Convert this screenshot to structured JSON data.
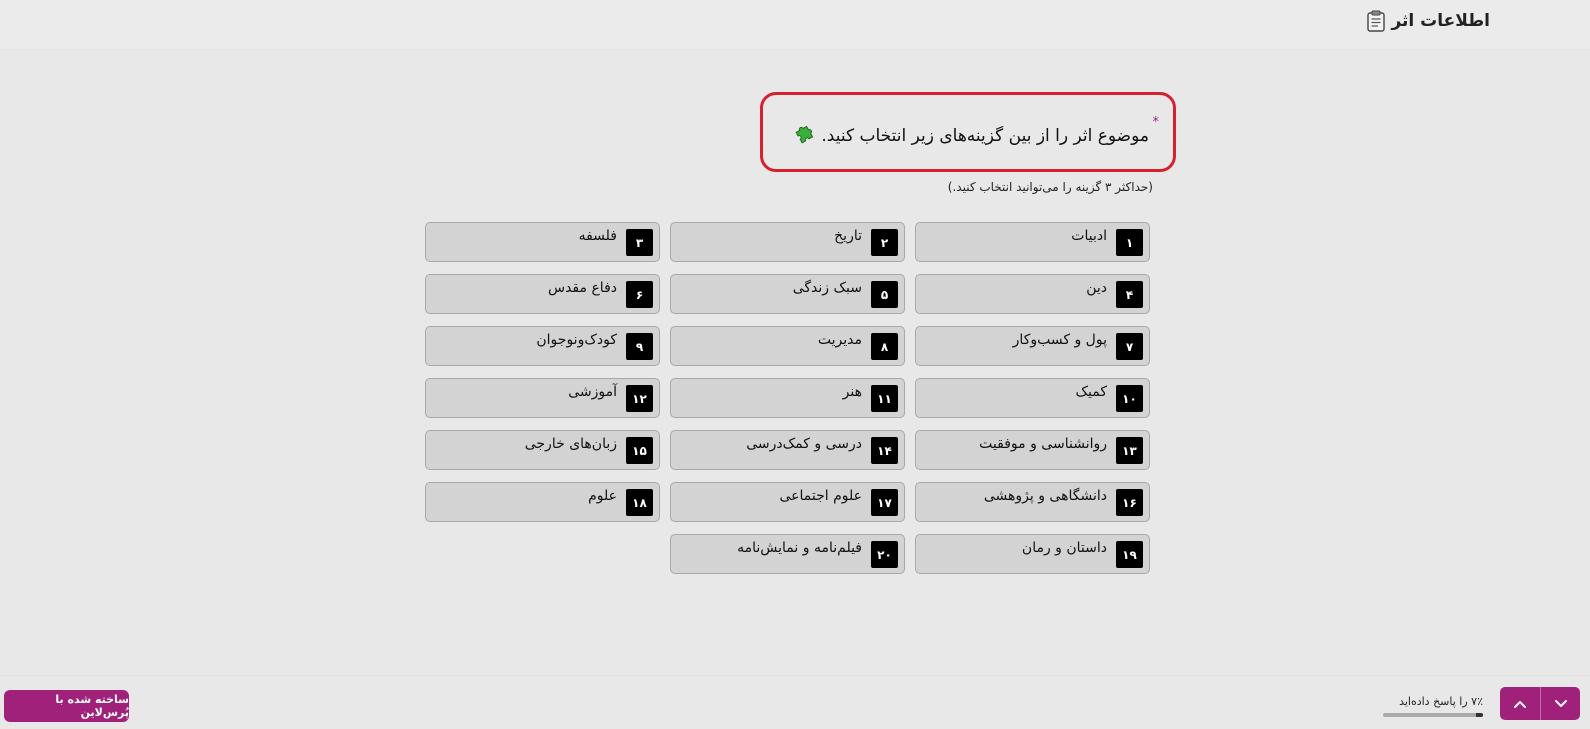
{
  "header": {
    "title": "اطلاعات اثر"
  },
  "question": {
    "required_mark": "*",
    "text": "موضوع اثر را از بین گزینه‌های زیر انتخاب کنید.",
    "hint": "(حداکثر ۳ گزینه را می‌توانید انتخاب کنید.)"
  },
  "options": [
    {
      "key": "۱",
      "label": "ادبیات"
    },
    {
      "key": "۲",
      "label": "تاریخ"
    },
    {
      "key": "۳",
      "label": "فلسفه"
    },
    {
      "key": "۴",
      "label": "دین"
    },
    {
      "key": "۵",
      "label": "سبک زندگی"
    },
    {
      "key": "۶",
      "label": "دفاع مقدس"
    },
    {
      "key": "۷",
      "label": "پول و کسب‌وکار"
    },
    {
      "key": "۸",
      "label": "مدیریت"
    },
    {
      "key": "۹",
      "label": "کودک‌ونوجوان"
    },
    {
      "key": "۱۰",
      "label": "کمیک"
    },
    {
      "key": "۱۱",
      "label": "هنر"
    },
    {
      "key": "۱۲",
      "label": "آموزشی"
    },
    {
      "key": "۱۳",
      "label": "روانشناسی و موفقیت"
    },
    {
      "key": "۱۴",
      "label": "درسی و کمک‌درسی"
    },
    {
      "key": "۱۵",
      "label": "زبان‌های خارجی"
    },
    {
      "key": "۱۶",
      "label": "دانشگاهی و پژوهشی"
    },
    {
      "key": "۱۷",
      "label": "علوم اجتماعی"
    },
    {
      "key": "۱۸",
      "label": "علوم"
    },
    {
      "key": "۱۹",
      "label": "داستان و رمان"
    },
    {
      "key": "۲۰",
      "label": "فیلم‌نامه و نمایش‌نامه"
    }
  ],
  "footer": {
    "brand_label": "ساخته شده با پُرس‌لاین",
    "progress_text": "۷٪ را پاسخ داده‌اید",
    "progress_percent": 7
  },
  "colors": {
    "accent": "#a02179",
    "highlight_border": "#d4222f",
    "option_bg": "#d3d3d3",
    "key_bg": "#000000"
  },
  "icons": {
    "header": "clipboard-icon",
    "question": "puzzle-icon",
    "nav_up": "chevron-up-icon",
    "nav_down": "chevron-down-icon"
  }
}
